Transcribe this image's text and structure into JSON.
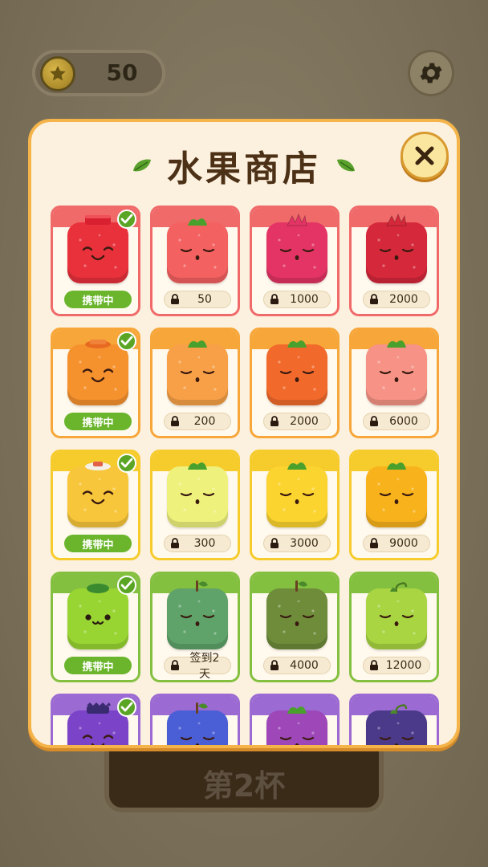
{
  "hud": {
    "coins": "50",
    "coin_icon": "star-coin-icon",
    "settings_icon": "gear-icon"
  },
  "background": {
    "cup_label": "第2杯"
  },
  "shop": {
    "title": "水果商店",
    "close_icon": "close-icon",
    "colors": {
      "red": "#f06060",
      "orange": "#f7a73a",
      "yellow": "#f6cb2c",
      "green": "#84c040",
      "purple": "#9b6ad2"
    },
    "rows": [
      {
        "band": "#f06a6a",
        "items": [
          {
            "color": "#e8313b",
            "status": "携带中",
            "owned": true,
            "face": "smile",
            "top": "lid-red"
          },
          {
            "color": "#f46161",
            "price": "50",
            "owned": false,
            "face": "sleep",
            "top": "leaf-green"
          },
          {
            "color": "#e33465",
            "price": "1000",
            "owned": false,
            "face": "sleep",
            "top": "leaf-red"
          },
          {
            "color": "#d5283a",
            "price": "2000",
            "owned": false,
            "face": "sleep",
            "top": "leaf-red"
          }
        ]
      },
      {
        "band": "#f7a73a",
        "items": [
          {
            "color": "#f6922e",
            "status": "携带中",
            "owned": true,
            "face": "smile",
            "top": "lid-orange"
          },
          {
            "color": "#f7a047",
            "price": "200",
            "owned": false,
            "face": "sleep",
            "top": "leaf-green"
          },
          {
            "color": "#f26a2b",
            "price": "2000",
            "owned": false,
            "face": "sleep",
            "top": "leaf-green"
          },
          {
            "color": "#f69386",
            "price": "6000",
            "owned": false,
            "face": "sleep",
            "top": "leaf-green"
          }
        ]
      },
      {
        "band": "#f6cb2c",
        "items": [
          {
            "color": "#f8c63a",
            "status": "携带中",
            "owned": true,
            "face": "smile",
            "top": "lid-white"
          },
          {
            "color": "#eef27c",
            "price": "300",
            "owned": false,
            "face": "sleep",
            "top": "leaf-green"
          },
          {
            "color": "#fbd42f",
            "price": "3000",
            "owned": false,
            "face": "sleep",
            "top": "leaf-green"
          },
          {
            "color": "#f8b21c",
            "price": "9000",
            "owned": false,
            "face": "sleep",
            "top": "leaf-green"
          }
        ]
      },
      {
        "band": "#84c040",
        "items": [
          {
            "color": "#98d532",
            "status": "携带中",
            "owned": true,
            "face": "cute",
            "top": "lid-green"
          },
          {
            "color": "#5fa36a",
            "price": "签到2天",
            "owned": false,
            "face": "sleep",
            "top": "stem-brown"
          },
          {
            "color": "#6e8c3a",
            "price": "4000",
            "owned": false,
            "face": "sleep",
            "top": "stem-brown"
          },
          {
            "color": "#a8d541",
            "price": "12000",
            "owned": false,
            "face": "sleep",
            "top": "stem-green"
          }
        ]
      },
      {
        "band": "#9b6ad2",
        "items": [
          {
            "color": "#7a43c8",
            "owned": true,
            "face": "smile",
            "top": "lid-purple"
          },
          {
            "color": "#4a5fd6",
            "owned": false,
            "face": "sleep",
            "top": "stem-brown"
          },
          {
            "color": "#9d47b8",
            "owned": false,
            "face": "sleep",
            "top": "leaf-green"
          },
          {
            "color": "#4b3a8a",
            "owned": false,
            "face": "sleep",
            "top": "stem-green"
          }
        ]
      }
    ]
  }
}
